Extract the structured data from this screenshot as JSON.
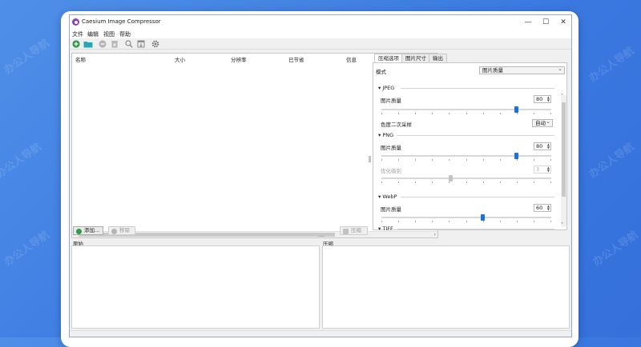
{
  "watermark_text": "办公人导航",
  "window": {
    "title": "Caesium Image Compressor",
    "minimize": "—",
    "maximize": "☐",
    "close": "✕"
  },
  "menu": [
    "文件",
    "编辑",
    "视图",
    "帮助"
  ],
  "toolbar_icons": [
    "add-file-icon",
    "add-folder-icon",
    "remove-icon",
    "clear-icon",
    "preview-icon",
    "compress-icon",
    "settings-icon"
  ],
  "file_list": {
    "columns": [
      "名称",
      "大小",
      "分辨率",
      "已节省",
      "信息"
    ]
  },
  "buttons": {
    "add": "添加...",
    "remove": "移除",
    "compress": "压缩"
  },
  "tabs": [
    "压缩选项",
    "图片尺寸",
    "输出"
  ],
  "mode": {
    "label": "模式",
    "value": "图片质量"
  },
  "jpeg": {
    "title": "JPEG",
    "quality_label": "图片质量",
    "quality": 80,
    "chroma_label": "色度二次采样",
    "chroma_value": "自动"
  },
  "png": {
    "title": "PNG",
    "quality_label": "图片质量",
    "quality": 80,
    "opt_label": "优化级别",
    "opt_level": 3
  },
  "webp": {
    "title": "WebP",
    "quality_label": "图片质量",
    "quality": 60
  },
  "tiff": {
    "title": "TIFF"
  },
  "preview": {
    "original_label": "原始",
    "compressed_label": "压缩"
  },
  "colors": {
    "accent": "#1a73d9",
    "background": "#3a78e0",
    "app_icon": "#8e3fb6"
  }
}
